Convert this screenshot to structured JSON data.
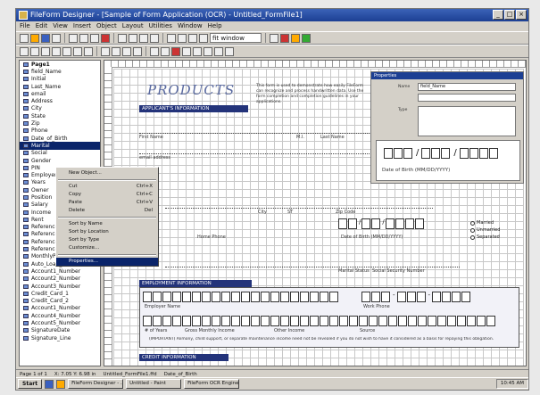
{
  "window": {
    "title": "FileForm Designer - [Sample of Form Application (OCR) - Untitled_FormFile1]",
    "controls": [
      "_",
      "□",
      "×"
    ]
  },
  "menu": [
    "File",
    "Edit",
    "View",
    "Insert",
    "Object",
    "Layout",
    "Utilities",
    "Window",
    "Help"
  ],
  "toolbar": {
    "zoom_value": "fit window"
  },
  "tree": {
    "root": "Page1",
    "items": [
      "field_Name",
      "Initial",
      "Last_Name",
      "email",
      "Address",
      "City",
      "State",
      "Zip",
      "Phone",
      "Date_of_Birth",
      "Marital",
      "Social",
      "Gender",
      "PIN",
      "Employer",
      "Years",
      "Owner",
      "Position",
      "Salary",
      "Income",
      "Rent",
      "Reference",
      "Reference2",
      "Reference3",
      "Reference4",
      "MonthlyPayment",
      "Auto_Loan_Amount",
      "Account1_Number",
      "Account2_Number",
      "Account3_Number",
      "Credit_Card_1",
      "Credit_Card_2",
      "Account1_Number",
      "Account4_Number",
      "Account5_Number",
      "SignatureDate",
      "Signature_Line"
    ],
    "selected_index": 10
  },
  "context_menu": {
    "items": [
      {
        "label": "New Object...",
        "shortcut": ""
      },
      {
        "sep": true
      },
      {
        "label": "Cut",
        "shortcut": "Ctrl+X"
      },
      {
        "label": "Copy",
        "shortcut": "Ctrl+C"
      },
      {
        "label": "Paste",
        "shortcut": "Ctrl+V"
      },
      {
        "label": "Delete",
        "shortcut": "Del"
      },
      {
        "sep": true
      },
      {
        "label": "Sort by Name",
        "shortcut": ""
      },
      {
        "label": "Sort by Location",
        "shortcut": ""
      },
      {
        "label": "Sort by Type",
        "shortcut": ""
      },
      {
        "label": "Customize...",
        "shortcut": ""
      },
      {
        "sep": true
      },
      {
        "label": "Properties...",
        "shortcut": "",
        "selected": true
      }
    ]
  },
  "form": {
    "logo": "PRODUCTS",
    "intro": "This form is used to demonstrate how easily FileForm can recognize and process handwritten data. Use the form completion and completion guidelines in your applications.",
    "sections": {
      "applicant": "APPLICANT'S INFORMATION",
      "employment": "EMPLOYMENT INFORMATION",
      "credit": "CREDIT INFORMATION"
    },
    "labels": {
      "first_name": "First Name",
      "mi": "M.I.",
      "last_name": "Last Name",
      "email": "email address",
      "city": "City",
      "state": "ST",
      "zip": "Zip Code",
      "phone": "Home Phone",
      "dob": "Date of Birth (MM/DD/YYYY)",
      "marital": "Marital Status",
      "ssn": "Social Security Number",
      "employer": "Employer Name",
      "work_phone": "Work Phone",
      "years": "# of Years",
      "gross_income": "Gross Monthly Income",
      "other_income": "Other Income",
      "source": "Source",
      "note": "(IMPORTANT) Alimony, child support, or separate maintenance income need not be revealed if you do not wish to have it considered as a basis for repaying this obligation."
    },
    "radio_options": [
      "Married",
      "Unmarried",
      "Separated"
    ]
  },
  "properties_window": {
    "title": "Properties",
    "name_label": "Name",
    "name_value": "field_Name",
    "type_label": "Type",
    "preview_caption": "Date of Birth (MM/DD/YYYY)"
  },
  "status": [
    "Page 1 of 1",
    "X: 7.05  Y: 6.98 in",
    "Untitled_FormFile1.ffd",
    "Date_of_Birth"
  ],
  "taskbar": {
    "start": "Start",
    "tasks": [
      "FileForm Designer - ...",
      "Untitled - Paint",
      "FileForm OCR Engine"
    ],
    "clock": "10:45 AM"
  }
}
